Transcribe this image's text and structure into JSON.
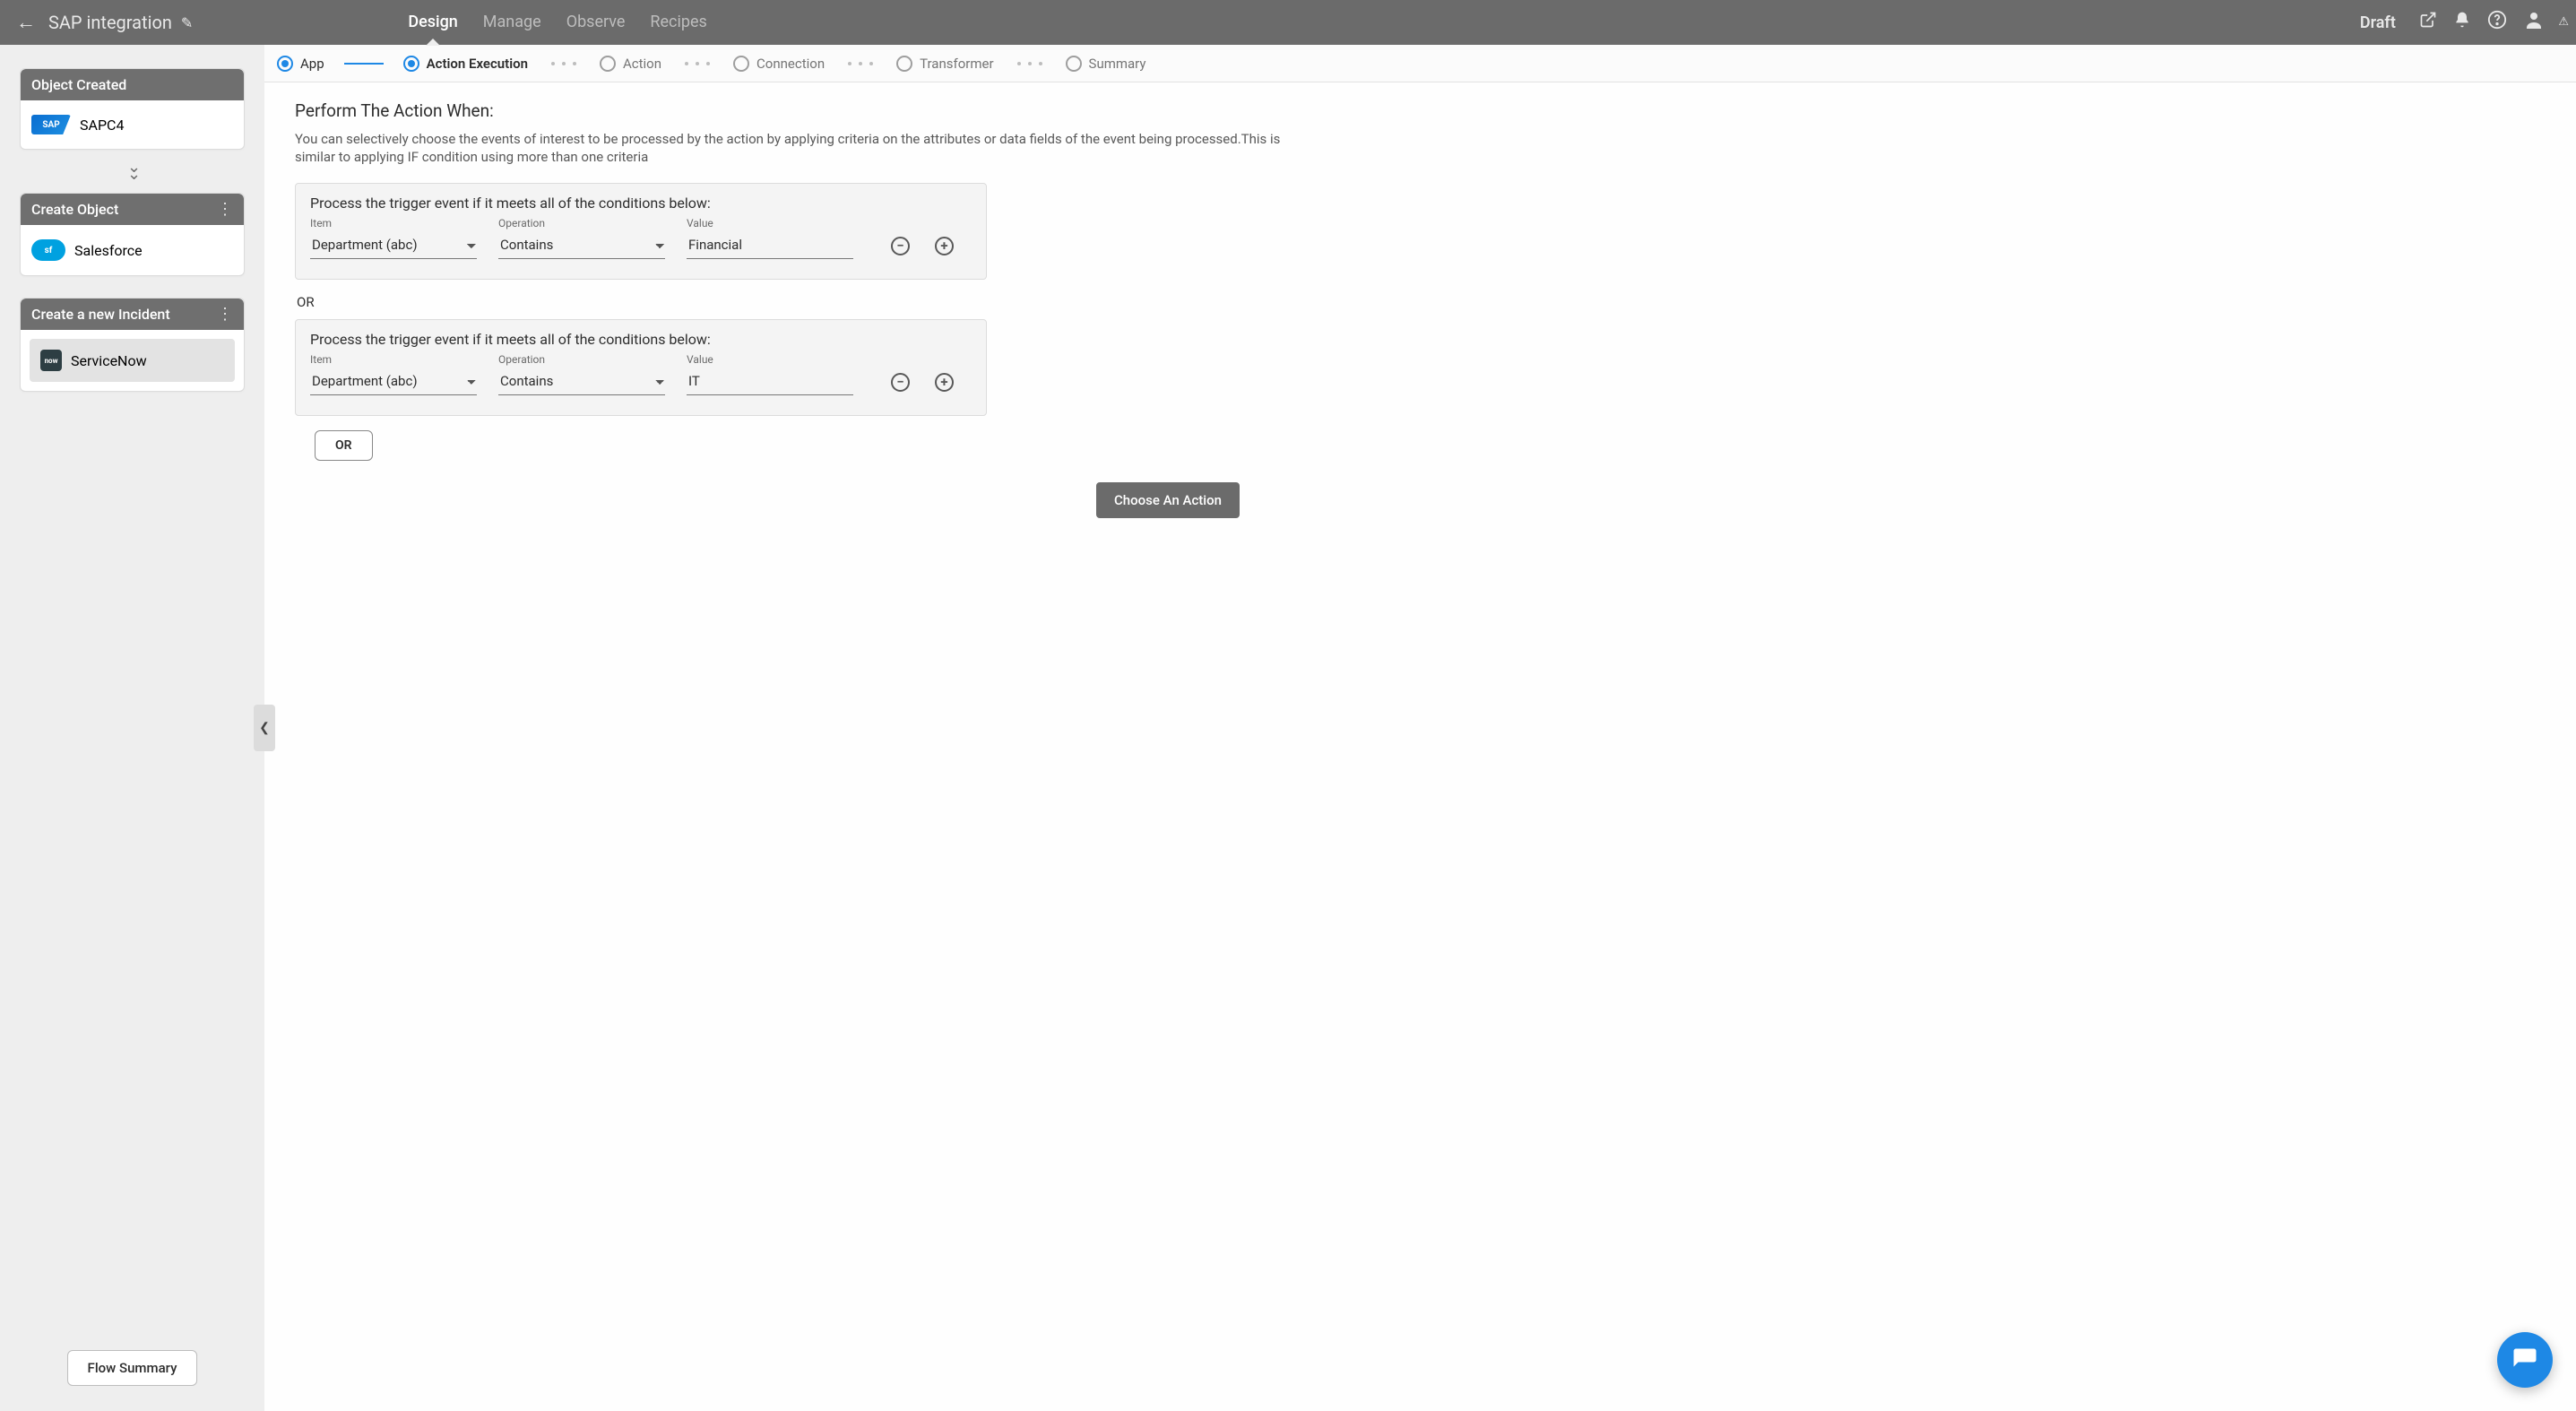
{
  "header": {
    "title": "SAP integration",
    "tabs": [
      "Design",
      "Manage",
      "Observe",
      "Recipes"
    ],
    "active_tab": "Design",
    "status": "Draft"
  },
  "sidebar": {
    "cards": [
      {
        "title": "Object Created",
        "app_label": "SAPC4",
        "logo": "SAP",
        "kebab": false,
        "selected": false
      },
      {
        "title": "Create Object",
        "app_label": "Salesforce",
        "logo": "salesforce",
        "kebab": true,
        "selected": false
      },
      {
        "title": "Create a new Incident",
        "app_label": "ServiceNow",
        "logo": "now",
        "kebab": true,
        "selected": true
      }
    ],
    "flow_summary_btn": "Flow Summary"
  },
  "stepper": {
    "steps": [
      "App",
      "Action Execution",
      "Action",
      "Connection",
      "Transformer",
      "Summary"
    ],
    "done_index": 0,
    "active_index": 1
  },
  "action_exec": {
    "title": "Perform The Action When:",
    "description": "You can selectively choose the events of interest to be processed by the action by applying criteria on the attributes or data fields of the event being processed.This is similar to applying IF condition using more than one criteria",
    "block_title": "Process the trigger event if it meets all of the conditions below:",
    "labels": {
      "item": "Item",
      "operation": "Operation",
      "value": "Value"
    },
    "or_separator": "OR",
    "or_button": "OR",
    "choose_action_btn": "Choose An Action",
    "blocks": [
      {
        "item": "Department (abc)",
        "operation": "Contains",
        "value": "Financial"
      },
      {
        "item": "Department (abc)",
        "operation": "Contains",
        "value": "IT"
      }
    ]
  }
}
